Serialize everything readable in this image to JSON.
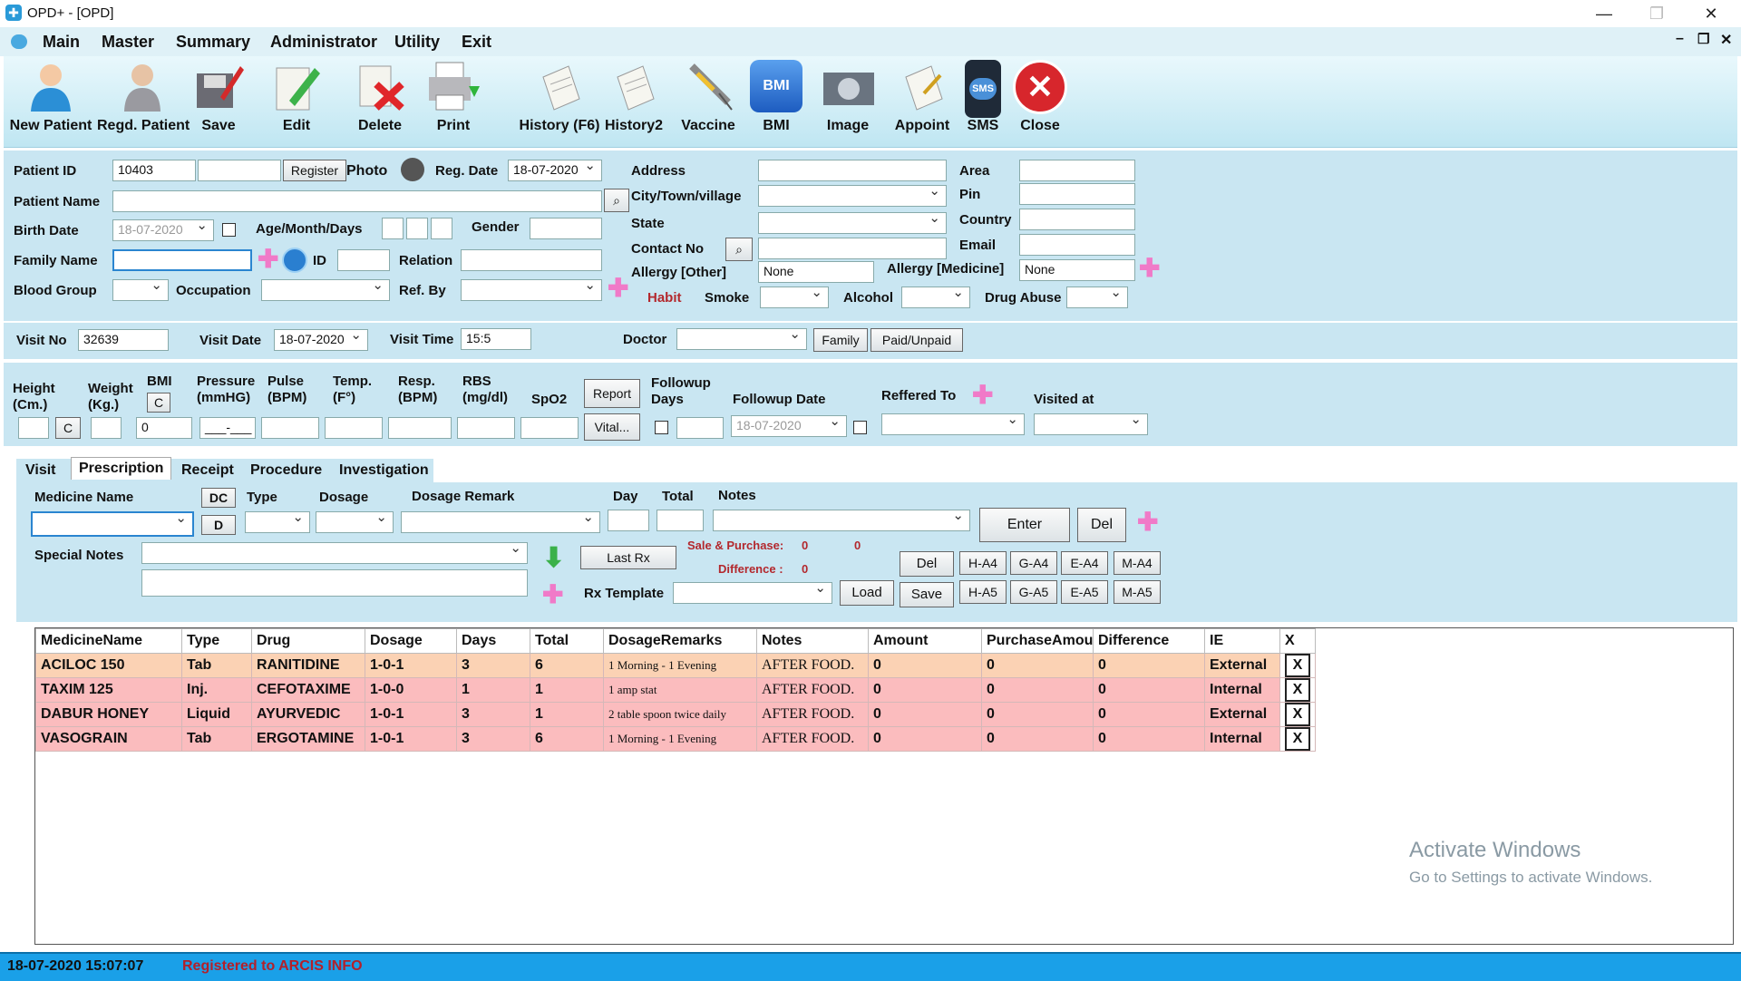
{
  "window": {
    "title": "OPD+ - [OPD]",
    "min": "—",
    "max": "❐",
    "close": "✕"
  },
  "menu": {
    "items": [
      "Main",
      "Master",
      "Summary",
      "Administrator",
      "Utility",
      "Exit"
    ]
  },
  "toolbar": {
    "items": [
      {
        "label": "New Patient",
        "icon": "new-patient-icon"
      },
      {
        "label": "Regd. Patient",
        "icon": "regd-patient-icon"
      },
      {
        "label": "Save",
        "icon": "save-icon"
      },
      {
        "label": "Edit",
        "icon": "edit-icon"
      },
      {
        "label": "Delete",
        "icon": "delete-icon"
      },
      {
        "label": "Print",
        "icon": "print-icon"
      },
      {
        "label": "History (F6)",
        "icon": "history-icon"
      },
      {
        "label": "History2",
        "icon": "history2-icon"
      },
      {
        "label": "Vaccine",
        "icon": "vaccine-icon"
      },
      {
        "label": "BMI",
        "icon": "bmi-icon",
        "badge": "BMI"
      },
      {
        "label": "Image",
        "icon": "image-icon"
      },
      {
        "label": "Appoint",
        "icon": "appoint-icon"
      },
      {
        "label": "SMS",
        "icon": "sms-icon",
        "badge": "SMS"
      },
      {
        "label": "Close",
        "icon": "close-icon"
      }
    ]
  },
  "patient": {
    "patient_id_label": "Patient ID",
    "patient_id": "10403",
    "register_btn": "Register",
    "photo_label": "Photo",
    "reg_date_label": "Reg. Date",
    "reg_date": "18-07-2020",
    "patient_name_label": "Patient Name",
    "birth_date_label": "Birth Date",
    "birth_date": "18-07-2020",
    "age_label": "Age/Month/Days",
    "gender_label": "Gender",
    "family_name_label": "Family Name",
    "id_label": "ID",
    "relation_label": "Relation",
    "blood_group_label": "Blood Group",
    "occupation_label": "Occupation",
    "ref_by_label": "Ref. By",
    "address_label": "Address",
    "city_label": "City/Town/village",
    "state_label": "State",
    "contact_label": "Contact No",
    "allergy_other_label": "Allergy [Other]",
    "allergy_other": "None",
    "allergy_medicine_label": "Allergy [Medicine]",
    "allergy_medicine": "None",
    "area_label": "Area",
    "pin_label": "Pin",
    "country_label": "Country",
    "email_label": "Email",
    "habit_label": "Habit",
    "smoke_label": "Smoke",
    "alcohol_label": "Alcohol",
    "drug_abuse_label": "Drug Abuse"
  },
  "visit": {
    "visit_no_label": "Visit No",
    "visit_no": "32639",
    "visit_date_label": "Visit Date",
    "visit_date": "18-07-2020",
    "visit_time_label": "Visit Time",
    "visit_time": "15:5",
    "doctor_label": "Doctor",
    "family_btn": "Family",
    "paid_btn": "Paid/Unpaid"
  },
  "vitals": {
    "height_label": "Height\n(Cm.)",
    "weight_label": "Weight\n(Kg.)",
    "bmi_label": "BMI",
    "c_label": "C",
    "bmi_value": "0",
    "pressure_label": "Pressure\n(mmHG)",
    "pressure_value": "___-___",
    "pulse_label": "Pulse\n(BPM)",
    "temp_label": "Temp.\n(F°)",
    "resp_label": "Resp.\n(BPM)",
    "rbs_label": "RBS\n(mg/dl)",
    "spo2_label": "SpO2",
    "report_btn": "Report",
    "vital_btn": "Vital...",
    "followup_days_label": "Followup\nDays",
    "followup_date_label": "Followup Date",
    "followup_date": "18-07-2020",
    "referred_label": "Reffered To",
    "visited_label": "Visited at"
  },
  "tabs": [
    "Visit",
    "Prescription",
    "Receipt",
    "Procedure",
    "Investigation"
  ],
  "rx": {
    "medicine_label": "Medicine Name",
    "dc_btn": "DC",
    "d_btn": "D",
    "type_label": "Type",
    "dosage_label": "Dosage",
    "dosage_remark_label": "Dosage Remark",
    "day_label": "Day",
    "total_label": "Total",
    "notes_label": "Notes",
    "enter_btn": "Enter",
    "del_btn": "Del",
    "special_notes_label": "Special Notes",
    "last_rx_btn": "Last Rx",
    "sale_label": "Sale & Purchase:",
    "sale_value": "0",
    "purchase_value": "0",
    "difference_label": "Difference :",
    "difference_value": "0",
    "rx_template_label": "Rx Template",
    "load_btn": "Load",
    "save_btn": "Save",
    "del2_btn": "Del",
    "print_btns_row1": [
      "H-A4",
      "G-A4",
      "E-A4",
      "M-A4"
    ],
    "print_btns_row2": [
      "H-A5",
      "G-A5",
      "E-A5",
      "M-A5"
    ]
  },
  "grid": {
    "columns": [
      "MedicineName",
      "Type",
      "Drug",
      "Dosage",
      "Days",
      "Total",
      "DosageRemarks",
      "Notes",
      "Amount",
      "PurchaseAmou",
      "Difference",
      "IE",
      "X"
    ],
    "rows": [
      [
        "ACILOC 150",
        "Tab",
        "RANITIDINE",
        "1-0-1",
        "3",
        "6",
        "1 Morning - 1 Evening",
        "AFTER FOOD.",
        "0",
        "0",
        "0",
        "External",
        "X"
      ],
      [
        "TAXIM 125",
        "Inj.",
        "CEFOTAXIME",
        "1-0-0",
        "1",
        "1",
        "1 amp stat",
        "AFTER FOOD.",
        "0",
        "0",
        "0",
        "Internal",
        "X"
      ],
      [
        "DABUR HONEY",
        "Liquid",
        "AYURVEDIC",
        "1-0-1",
        "3",
        "1",
        "2 table spoon twice daily",
        "AFTER FOOD.",
        "0",
        "0",
        "0",
        "External",
        "X"
      ],
      [
        "VASOGRAIN",
        "Tab",
        "ERGOTAMINE",
        "1-0-1",
        "3",
        "6",
        "1 Morning - 1 Evening",
        "AFTER FOOD.",
        "0",
        "0",
        "0",
        "Internal",
        "X"
      ]
    ]
  },
  "watermark": {
    "line1": "Activate Windows",
    "line2": "Go to Settings to activate Windows."
  },
  "status": {
    "datetime": "18-07-2020 15:07:07",
    "registered": "Registered to ARCIS INFO"
  }
}
